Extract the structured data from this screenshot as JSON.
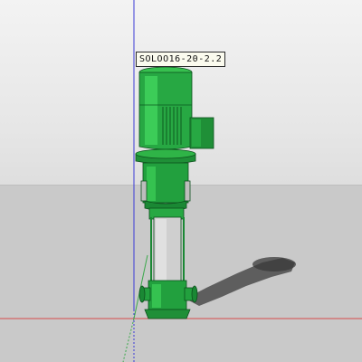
{
  "viewport": {
    "model_tag": "SOLOO16-20-2.2"
  },
  "colors": {
    "sky": "#e6e6e6",
    "ground": "#c9c9c9",
    "pump_green": "#25a640",
    "pump_dark_green": "#157a2c",
    "steel": "#c8c8c8",
    "axis_blue": "#3b3bd6",
    "axis_red": "#d64a4a",
    "axis_green": "#3aa84a"
  },
  "icons": [
    "pump-model"
  ]
}
